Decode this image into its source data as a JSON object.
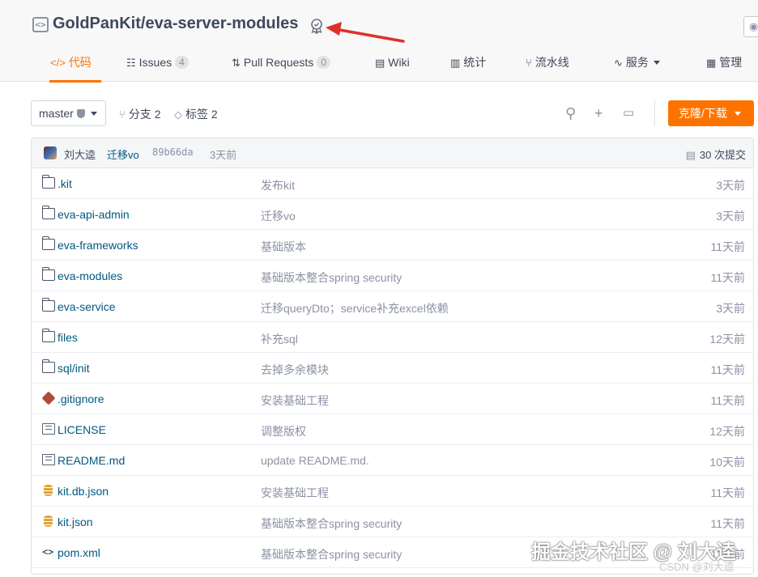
{
  "repo": {
    "title": "GoldPanKit/eva-server-modules",
    "icon": "code-repo-icon",
    "badge_icon": "award-badge-icon",
    "annotation": "red-arrow-pointing-at-badge"
  },
  "tabs": [
    {
      "label": "代码",
      "icon": "</>",
      "active": true
    },
    {
      "label": "Issues",
      "icon": "issues-icon",
      "count": "4"
    },
    {
      "label": "Pull Requests",
      "icon": "pull-request-icon",
      "count": "0"
    },
    {
      "label": "Wiki",
      "icon": "wiki-icon"
    },
    {
      "label": "统计",
      "icon": "stats-icon"
    },
    {
      "label": "流水线",
      "icon": "pipeline-icon"
    },
    {
      "label": "服务",
      "icon": "service-icon",
      "dropdown": true
    },
    {
      "label": "管理",
      "icon": "manage-icon"
    }
  ],
  "toolbar": {
    "branch": "master",
    "branches_label": "分支 2",
    "tags_label": "标签 2",
    "clone_label": "克隆/下载"
  },
  "commit": {
    "author": "刘大逵",
    "message": "迁移vo",
    "hash": "89b66da",
    "time": "3天前",
    "count_label": "30 次提交"
  },
  "files": [
    {
      "name": ".kit",
      "type": "folder",
      "message": "发布kit",
      "time": "3天前"
    },
    {
      "name": "eva-api-admin",
      "type": "folder",
      "message": "迁移vo",
      "time": "3天前"
    },
    {
      "name": "eva-frameworks",
      "type": "folder",
      "message": "基础版本",
      "time": "11天前"
    },
    {
      "name": "eva-modules",
      "type": "folder",
      "message": "基础版本整合spring security",
      "time": "11天前"
    },
    {
      "name": "eva-service",
      "type": "folder",
      "message": "迁移queryDto；service补充excel依赖",
      "time": "3天前"
    },
    {
      "name": "files",
      "type": "folder",
      "message": "补充sql",
      "time": "12天前"
    },
    {
      "name": "sql/init",
      "type": "folder",
      "message": "去掉多余模块",
      "time": "11天前"
    },
    {
      "name": ".gitignore",
      "type": "git",
      "message": "安装基础工程",
      "time": "11天前"
    },
    {
      "name": "LICENSE",
      "type": "doc",
      "message": "调整版权",
      "time": "12天前"
    },
    {
      "name": "README.md",
      "type": "doc",
      "message": "update README.md.",
      "time": "10天前"
    },
    {
      "name": "kit.db.json",
      "type": "db",
      "message": "安装基础工程",
      "time": "11天前"
    },
    {
      "name": "kit.json",
      "type": "db",
      "message": "基础版本整合spring security",
      "time": "11天前"
    },
    {
      "name": "pom.xml",
      "type": "code",
      "message": "基础版本整合spring security",
      "time": "11天前"
    }
  ],
  "watermark": {
    "main": "掘金技术社区 @ 刘大逵",
    "csdn": "CSDN @刘大逵"
  },
  "colors": {
    "accent": "#fe7300",
    "link": "#005980",
    "muted": "#8c92a4",
    "arrow": "#e0302a"
  }
}
